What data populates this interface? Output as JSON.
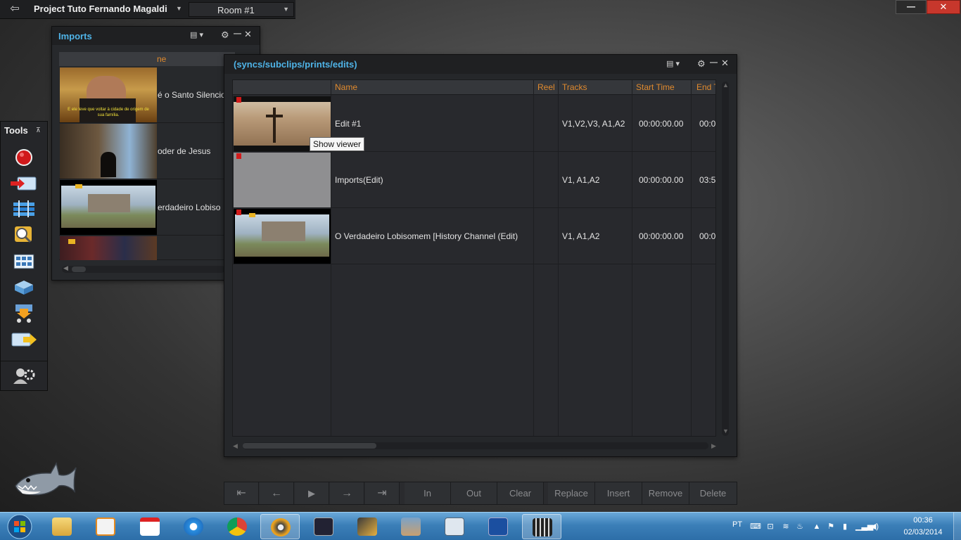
{
  "topbar": {
    "project_title": "Project Tuto Fernando Magaldi",
    "room": "Room #1"
  },
  "window_controls": {
    "minimize": "—",
    "close": "✕"
  },
  "imports_panel": {
    "title": "Imports",
    "column_name": "ne",
    "rows": [
      {
        "name": "é o Santo Silencio",
        "subtitle": "E ele teve que voltar à cidade de origem de sua família."
      },
      {
        "name": "oder de Jesus"
      },
      {
        "name": "erdadeiro Lobiso"
      },
      {
        "name": ""
      }
    ]
  },
  "tools_panel": {
    "title": "Tools",
    "items": [
      "record-tool",
      "import-tool",
      "timeline-tool",
      "search-tool",
      "storyboard-tool",
      "library-tool",
      "export-tool",
      "send-to-tool",
      "users-tool"
    ]
  },
  "bin_panel": {
    "title": "(syncs/subclips/prints/edits)",
    "columns": {
      "name": "Name",
      "reel": "Reel",
      "tracks": "Tracks",
      "start": "Start Time",
      "end": "End T"
    },
    "rows": [
      {
        "name": "Edit #1",
        "reel": "",
        "tracks": "V1,V2,V3, A1,A2",
        "start": "00:00:00.00",
        "end": "00:0"
      },
      {
        "name": "Imports(Edit)",
        "reel": "",
        "tracks": "V1, A1,A2",
        "start": "00:00:00.00",
        "end": "03:5"
      },
      {
        "name": "O Verdadeiro Lobisomem [History Channel (Edit)",
        "reel": "",
        "tracks": "V1, A1,A2",
        "start": "00:00:00.00",
        "end": "00:0"
      }
    ]
  },
  "tooltip": "Show viewer",
  "transport": {
    "go_start": "⇤",
    "back": "←",
    "play": "▶",
    "forward": "→",
    "go_end": "⇥",
    "in": "In",
    "out": "Out",
    "clear": "Clear",
    "replace": "Replace",
    "insert": "Insert",
    "remove": "Remove",
    "delete": "Delete"
  },
  "taskbar": {
    "language": "PT",
    "time": "00:36",
    "date": "02/03/2014"
  }
}
